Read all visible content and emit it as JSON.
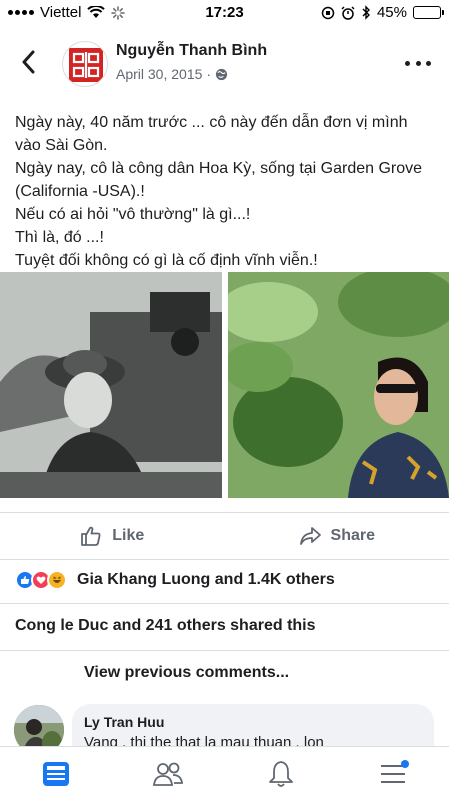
{
  "status_bar": {
    "carrier": "Viettel",
    "time": "17:23",
    "battery": "45%",
    "battery_level": 0.45
  },
  "post": {
    "author": "Nguyễn Thanh Bình",
    "date": "April 30, 2015",
    "visibility_icon": "globe-icon",
    "text_lines": [
      "Ngày này, 40 năm trước ... cô này đến dẫn đơn vị mình vào Sài Gòn.",
      "Ngày nay, cô là công dân Hoa Kỳ, sống tại Garden Grove (California -USA).!",
      "Nếu có ai hỏi \"vô thường\" là gì...!",
      "Thì là, đó ...!",
      "Tuyệt đối không có gì là cố định vĩnh viễn.!"
    ]
  },
  "actions": {
    "like_label": "Like",
    "share_label": "Share"
  },
  "reactions": {
    "summary": "Gia Khang Luong and 1.4K others",
    "types": [
      "like",
      "love",
      "haha"
    ]
  },
  "shares": {
    "summary": "Cong le Duc and 241 others shared this"
  },
  "comments": {
    "view_previous": "View previous comments...",
    "items": [
      {
        "author": "Ly Tran Huu",
        "text": "Vang , thi the that la mau thuan , lon"
      }
    ]
  },
  "bottom_nav": {
    "items": [
      "news-feed-icon",
      "friends-icon",
      "notifications-icon",
      "menu-icon"
    ]
  },
  "colors": {
    "accent": "#1877f2",
    "text": "#1c1e21",
    "secondary": "#606770"
  }
}
